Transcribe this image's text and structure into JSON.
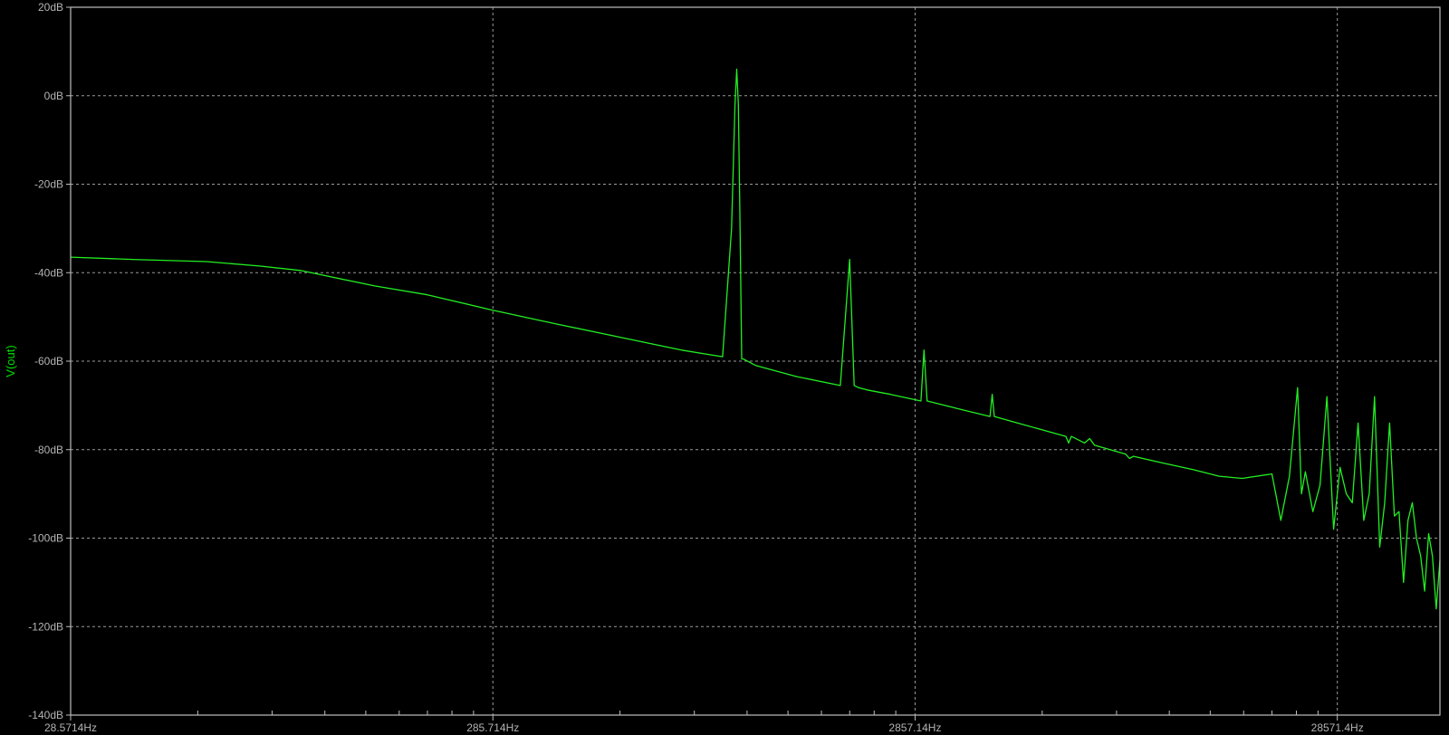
{
  "chart_data": {
    "type": "line",
    "title": "",
    "xlabel": "",
    "ylabel": "V(out)",
    "x_scale": "log",
    "xlim": [
      28.5714,
      50000
    ],
    "ylim": [
      -140,
      20
    ],
    "grid": true,
    "colors": {
      "background": "#000000",
      "frame": "#bdbdbd",
      "grid": "#9a9a9a",
      "trace": "#22ee22",
      "label_trace": "#00e000"
    },
    "x_ticks": [
      {
        "value": 28.5714,
        "label": "28.5714Hz"
      },
      {
        "value": 285.714,
        "label": "285.714Hz"
      },
      {
        "value": 2857.14,
        "label": "2857.14Hz"
      },
      {
        "value": 28571.4,
        "label": "28571.4Hz"
      }
    ],
    "y_ticks": [
      {
        "value": 20,
        "label": "20dB"
      },
      {
        "value": 0,
        "label": "0dB"
      },
      {
        "value": -20,
        "label": "-20dB"
      },
      {
        "value": -40,
        "label": "-40dB"
      },
      {
        "value": -60,
        "label": "-60dB"
      },
      {
        "value": -80,
        "label": "-80dB"
      },
      {
        "value": -100,
        "label": "-100dB"
      },
      {
        "value": -120,
        "label": "-120dB"
      },
      {
        "value": -140,
        "label": "-140dB"
      }
    ],
    "series": [
      {
        "name": "V(out)",
        "x": [
          28.5714,
          40,
          60,
          80,
          100,
          150,
          200,
          285.714,
          400,
          600,
          800,
          1000,
          1050,
          1070,
          1080,
          1090,
          1100,
          1110,
          1120,
          1200,
          1500,
          1900,
          2000,
          2050,
          2100,
          2200,
          2500,
          2950,
          3000,
          3050,
          3200,
          3700,
          4300,
          4350,
          4400,
          5000,
          6500,
          6600,
          6700,
          7200,
          7400,
          7600,
          9000,
          9200,
          9400,
          11000,
          13000,
          15000,
          17000,
          20000,
          21000,
          22000,
          23000,
          23500,
          24000,
          25000,
          26000,
          27000,
          28000,
          29000,
          30000,
          31000,
          32000,
          33000,
          34000,
          35000,
          36000,
          37000,
          38000,
          39000,
          40000,
          41000,
          42000,
          43000,
          44000,
          45000,
          46000,
          47000,
          48000,
          49000,
          50000
        ],
        "y": [
          -36.5,
          -37,
          -37.5,
          -38.5,
          -39.5,
          -43,
          -45,
          -48.5,
          -51.5,
          -55,
          -57.5,
          -59,
          -30,
          -2,
          6,
          -2,
          -30,
          -59.5,
          -59.5,
          -61,
          -63.5,
          -65.5,
          -37,
          -65.5,
          -66,
          -66.5,
          -67.5,
          -69,
          -57.5,
          -69,
          -69.5,
          -71,
          -72.5,
          -67.5,
          -72.5,
          -74,
          -77,
          -78.5,
          -77,
          -78.5,
          -77.5,
          -79,
          -81,
          -82,
          -81.5,
          -83,
          -84.5,
          -86,
          -86.5,
          -85.5,
          -96,
          -86,
          -66,
          -90,
          -85,
          -94,
          -88,
          -68,
          -98,
          -84,
          -90,
          -92,
          -74,
          -96,
          -90,
          -68,
          -102,
          -92,
          -74,
          -95,
          -94,
          -110,
          -96,
          -92,
          -100,
          -104,
          -112,
          -99,
          -104,
          -116,
          -105
        ]
      }
    ]
  }
}
